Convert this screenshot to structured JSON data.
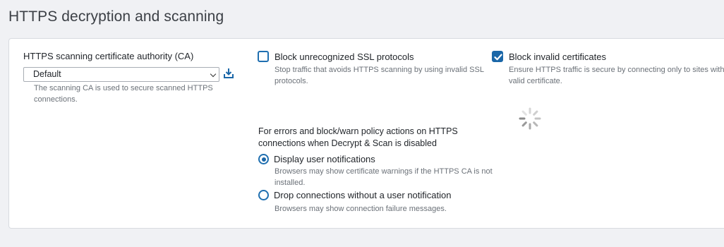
{
  "section": {
    "title": "HTTPS decryption and scanning"
  },
  "ca": {
    "label": "HTTPS scanning certificate authority (CA)",
    "selected": "Default",
    "help": "The scanning CA is used to secure scanned HTTPS connections.",
    "download_icon": "download-icon"
  },
  "ssl": {
    "label": "Block unrecognized SSL protocols",
    "checked": false,
    "help": "Stop traffic that avoids HTTPS scanning by using invalid SSL protocols."
  },
  "invalid_certs": {
    "label": "Block invalid certificates",
    "checked": true,
    "help": "Ensure HTTPS traffic is secure by connecting only to sites with a valid certificate."
  },
  "policy": {
    "text": "For errors and block/warn policy actions on HTTPS connections when Decrypt & Scan is disabled",
    "options": [
      {
        "label": "Display user notifications",
        "selected": true,
        "help": "Browsers may show certificate warnings if the HTTPS CA is not installed."
      },
      {
        "label": "Drop connections without a user notification",
        "selected": false,
        "help": "Browsers may show connection failure messages."
      }
    ]
  },
  "colors": {
    "accent": "#1b67a8",
    "help_text": "#6b7178",
    "background": "#f0f1f4"
  },
  "loading_icon": "spinner-icon"
}
